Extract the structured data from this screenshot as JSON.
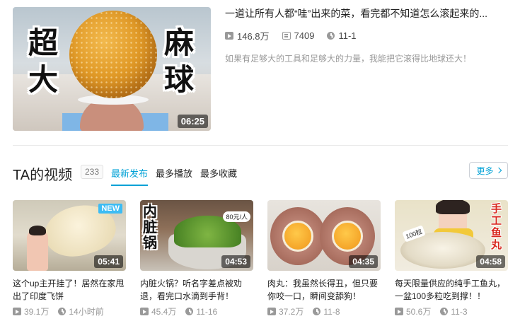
{
  "featured": {
    "big_chars_left": [
      "超",
      "大"
    ],
    "big_chars_right": [
      "麻",
      "球"
    ],
    "duration": "06:25",
    "title": "一道让所有人都“哇”出来的菜，看完都不知道怎么滚起来的...",
    "views": "146.8万",
    "danmaku": "7409",
    "date": "11-1",
    "description": "如果有足够大的工具和足够大的力量，我能把它滚得比地球还大！"
  },
  "section": {
    "title": "TA的视频",
    "count": "233",
    "tabs": [
      "最新发布",
      "最多播放",
      "最多收藏"
    ],
    "active_tab": "最新发布",
    "more_label": "更多"
  },
  "videos": [
    {
      "title": "这个up主开挂了！居然在家甩出了印度飞饼",
      "duration": "05:41",
      "views": "39.1万",
      "time": "14小时前",
      "badge": "NEW"
    },
    {
      "title": "内脏火锅？听名字差点被劝退，看完口水滴到手背！",
      "duration": "04:53",
      "views": "45.4万",
      "time": "11-16",
      "overlay_text": "内脏锅",
      "overlay_tag": "80元/人"
    },
    {
      "title": "肉丸：我虽然长得丑，但只要你咬一口，瞬间变舔狗！",
      "duration": "04:35",
      "views": "37.2万",
      "time": "11-8"
    },
    {
      "title": "每天限量供应的纯手工鱼丸，一盆100多粒吃到撑！！",
      "duration": "04:58",
      "views": "50.6万",
      "time": "11-3",
      "overlay_text": "手工鱼丸",
      "overlay_tag": "100粒"
    }
  ],
  "colors": {
    "accent": "#00a1d6",
    "new_badge": "#3cbcf4"
  }
}
